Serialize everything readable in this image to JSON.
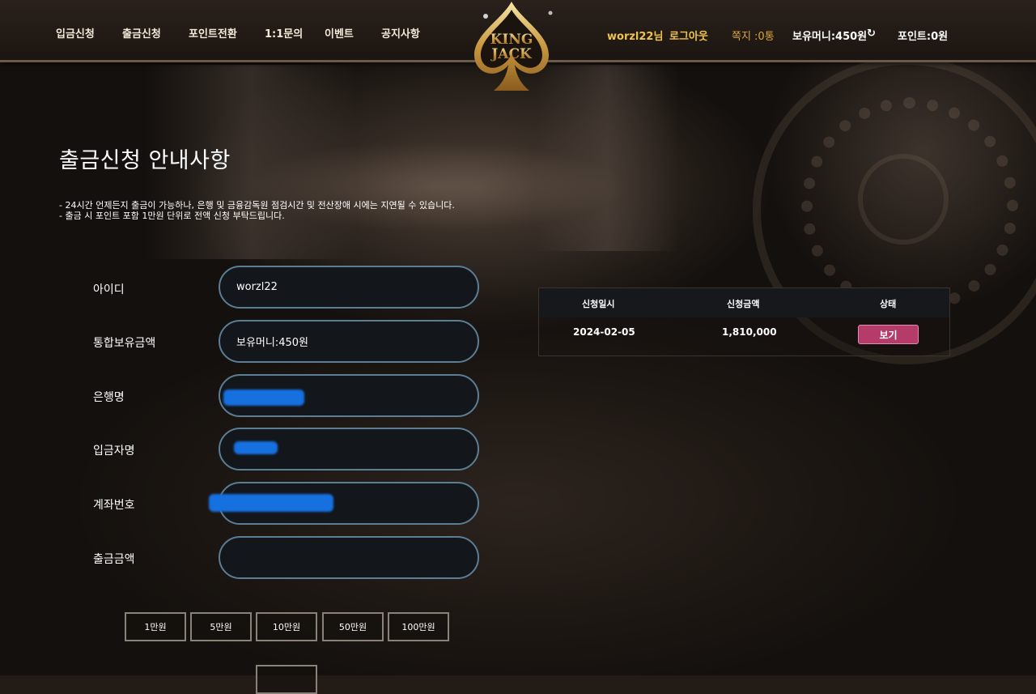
{
  "nav": {
    "deposit": "입금신청",
    "withdraw": "출금신청",
    "point_exchange": "포인트전환",
    "inquiry": "1:1문의",
    "event": "이벤트",
    "notice": "공지사항"
  },
  "logo": {
    "line1": "KING",
    "line2": "JACK"
  },
  "user": {
    "name": "worzl22님",
    "logout": "로그아웃",
    "messages": "쪽지 :0통",
    "money": "보유머니:450원",
    "money_icon": "refresh-icon",
    "points": "포인트:0원"
  },
  "page": {
    "title": "출금신청 안내사항",
    "notice_1": "- 24시간 언제든지 출금이 가능하나, 은행 및 금융감독원 점검시간 및 전산장애 시에는 지연될 수 있습니다.",
    "notice_2": "- 출금 시 포인트 포함 1만원 단위로 전액 신청 부탁드립니다."
  },
  "form": {
    "id_label": "아이디",
    "id_value": "worzl22",
    "balance_label": "통합보유금액",
    "balance_value": "보유머니:450원",
    "bank_label": "은행명",
    "bank_value": "",
    "depositor_label": "입금자명",
    "depositor_value": "",
    "account_label": "계좌번호",
    "account_value": "",
    "amount_label": "출금금액",
    "amount_value": ""
  },
  "amount_buttons": [
    "1만원",
    "5만원",
    "10만원",
    "50만원",
    "100만원"
  ],
  "history": {
    "headers": [
      "신청일시",
      "신청금액",
      "상태"
    ],
    "rows": [
      {
        "date": "2024-02-05",
        "amount": "1,810,000",
        "status": "보기"
      }
    ]
  },
  "colors": {
    "gold": "#f0c44a",
    "field_border": "#5c7e95",
    "status_button": "#b53b6a",
    "redaction": "#1670e0"
  }
}
